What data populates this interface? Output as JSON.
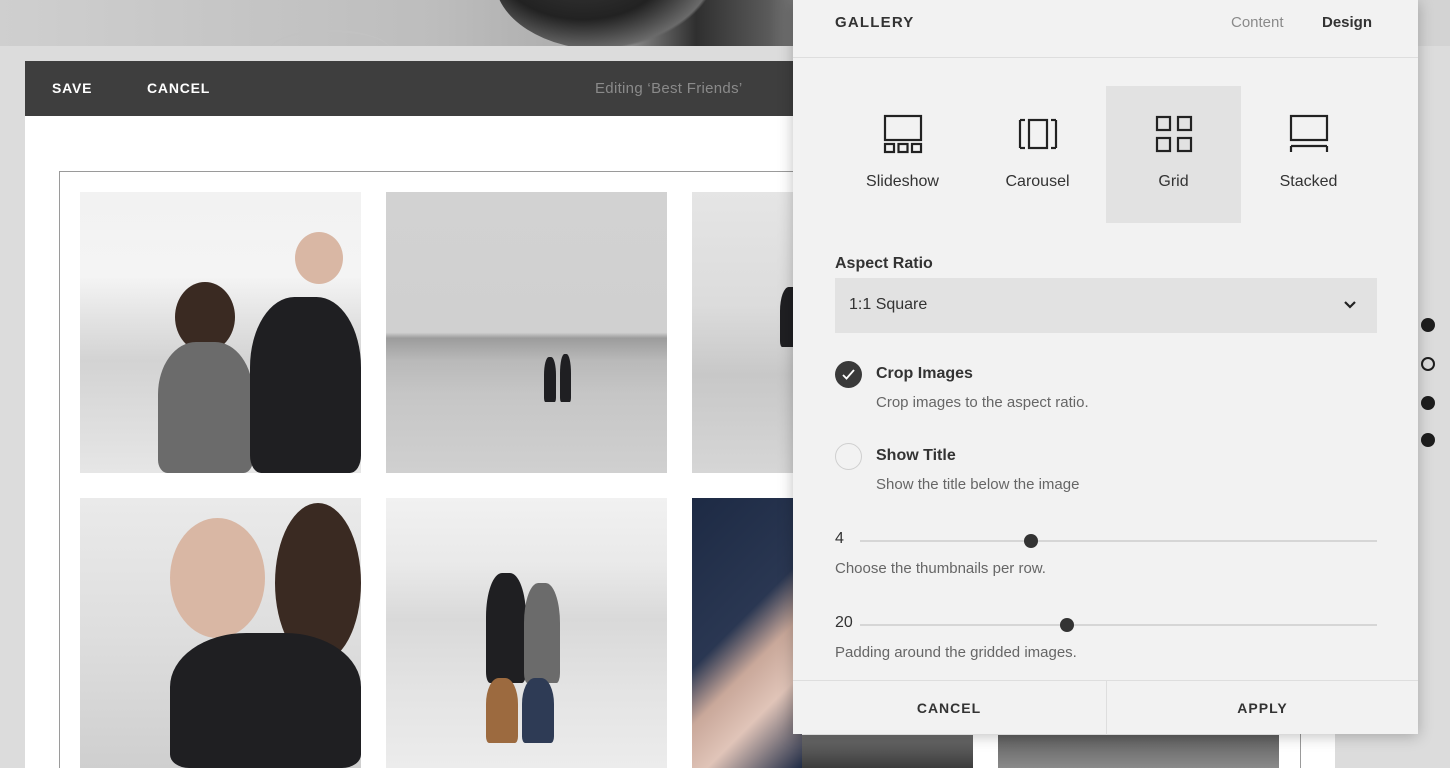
{
  "toolbar": {
    "save_label": "SAVE",
    "cancel_label": "CANCEL",
    "editing_title": "Editing ‘Best Friends’"
  },
  "panel": {
    "title": "GALLERY",
    "tabs": [
      {
        "label": "Content",
        "active": false
      },
      {
        "label": "Design",
        "active": true
      }
    ],
    "layouts": [
      {
        "label": "Slideshow",
        "icon": "slideshow-icon",
        "selected": false
      },
      {
        "label": "Carousel",
        "icon": "carousel-icon",
        "selected": false
      },
      {
        "label": "Grid",
        "icon": "grid-icon",
        "selected": true
      },
      {
        "label": "Stacked",
        "icon": "stacked-icon",
        "selected": false
      }
    ],
    "aspect_ratio": {
      "label": "Aspect Ratio",
      "value": "1:1 Square"
    },
    "crop_images": {
      "title": "Crop Images",
      "description": "Crop images to the aspect ratio.",
      "checked": true
    },
    "show_title": {
      "title": "Show Title",
      "description": "Show the title below the image",
      "checked": false
    },
    "thumbnails_slider": {
      "value": "4",
      "description": "Choose the thumbnails per row.",
      "fraction": 0.33
    },
    "padding_slider": {
      "value": "20",
      "description": "Padding around the gridded images.",
      "fraction": 0.4
    },
    "footer": {
      "cancel_label": "CANCEL",
      "apply_label": "APPLY"
    }
  },
  "pagination_dots": [
    {
      "active": false
    },
    {
      "active": true
    },
    {
      "active": false
    },
    {
      "active": false
    }
  ],
  "colors": {
    "toolbar_bg": "#3e3e3e",
    "panel_bg": "#f2f2f2",
    "selected_option_bg": "#e2e2e2",
    "checkbox_on": "#3a3a3a"
  }
}
